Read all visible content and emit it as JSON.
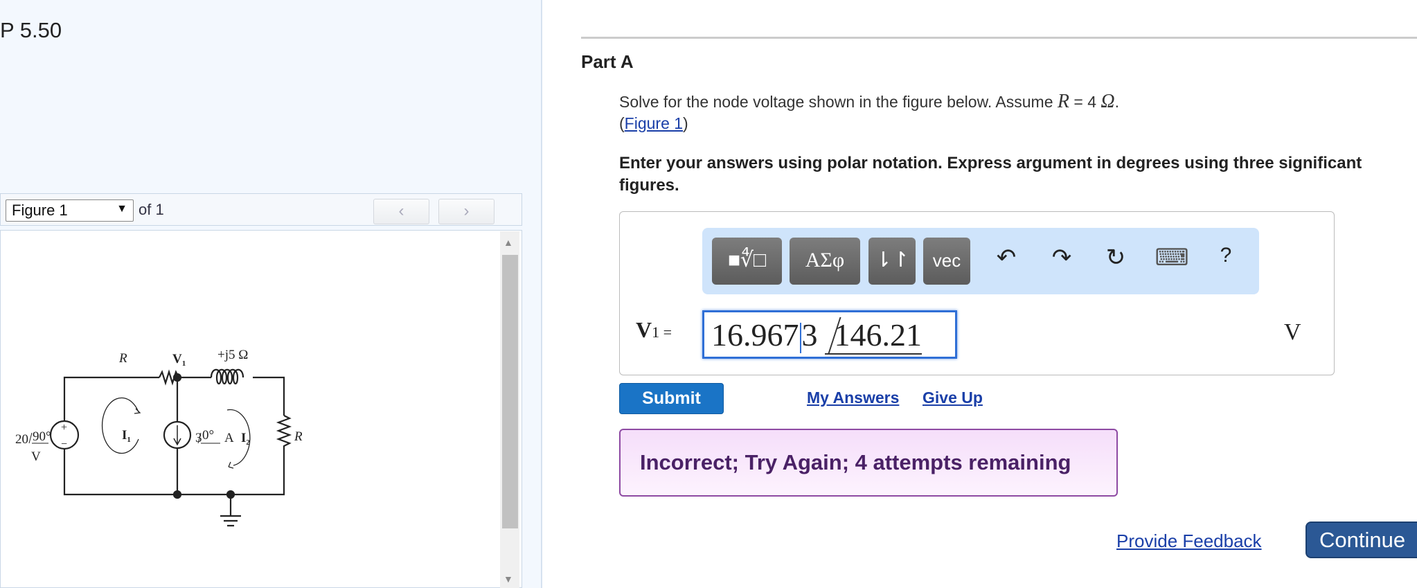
{
  "problem": {
    "title": "P 5.50"
  },
  "figure_nav": {
    "selected": "Figure 1",
    "of": "of 1",
    "prev": "‹",
    "next": "›"
  },
  "circuit": {
    "source_mag": "20",
    "source_ang": "90°",
    "source_unit": "V",
    "plus": "+",
    "minus": "−",
    "r_top": "R",
    "node": "V",
    "node_sub": "1",
    "inductor": "+j5 Ω",
    "current_mag": "3",
    "current_ang": "0°",
    "current_unit": "A",
    "mesh1": "I",
    "mesh1_sub": "1",
    "mesh2": "I",
    "mesh2_sub": "2",
    "r_right": "R"
  },
  "part": {
    "label": "Part A"
  },
  "question": {
    "text": "Solve for the node voltage shown in the figure below. Assume ",
    "var": "R",
    "eq": " = 4 ",
    "unit": "Ω",
    "end": ".",
    "fig_open": "(",
    "fig_link": "Figure 1",
    "fig_close": ")"
  },
  "instructions": "Enter your answers using polar notation. Express argument in degrees using three significant figures.",
  "toolbar": {
    "templates": "■∜□",
    "greek": "ΑΣφ",
    "arrows": "⇂↾",
    "vec": "vec",
    "undo": "↶",
    "redo": "↷",
    "reset": "↻",
    "keyboard": "⌨",
    "help": "?"
  },
  "answer": {
    "label": "V",
    "label_sub": "1",
    "equals": " =",
    "mag_before": "16.967",
    "mag_after": "3",
    "angle": "146.21",
    "unit": "V"
  },
  "buttons": {
    "submit": "Submit",
    "my_answers": "My Answers",
    "give_up": "Give Up",
    "provide_feedback": "Provide Feedback",
    "continue": "Continue"
  },
  "feedback": "Incorrect; Try Again; 4 attempts remaining"
}
